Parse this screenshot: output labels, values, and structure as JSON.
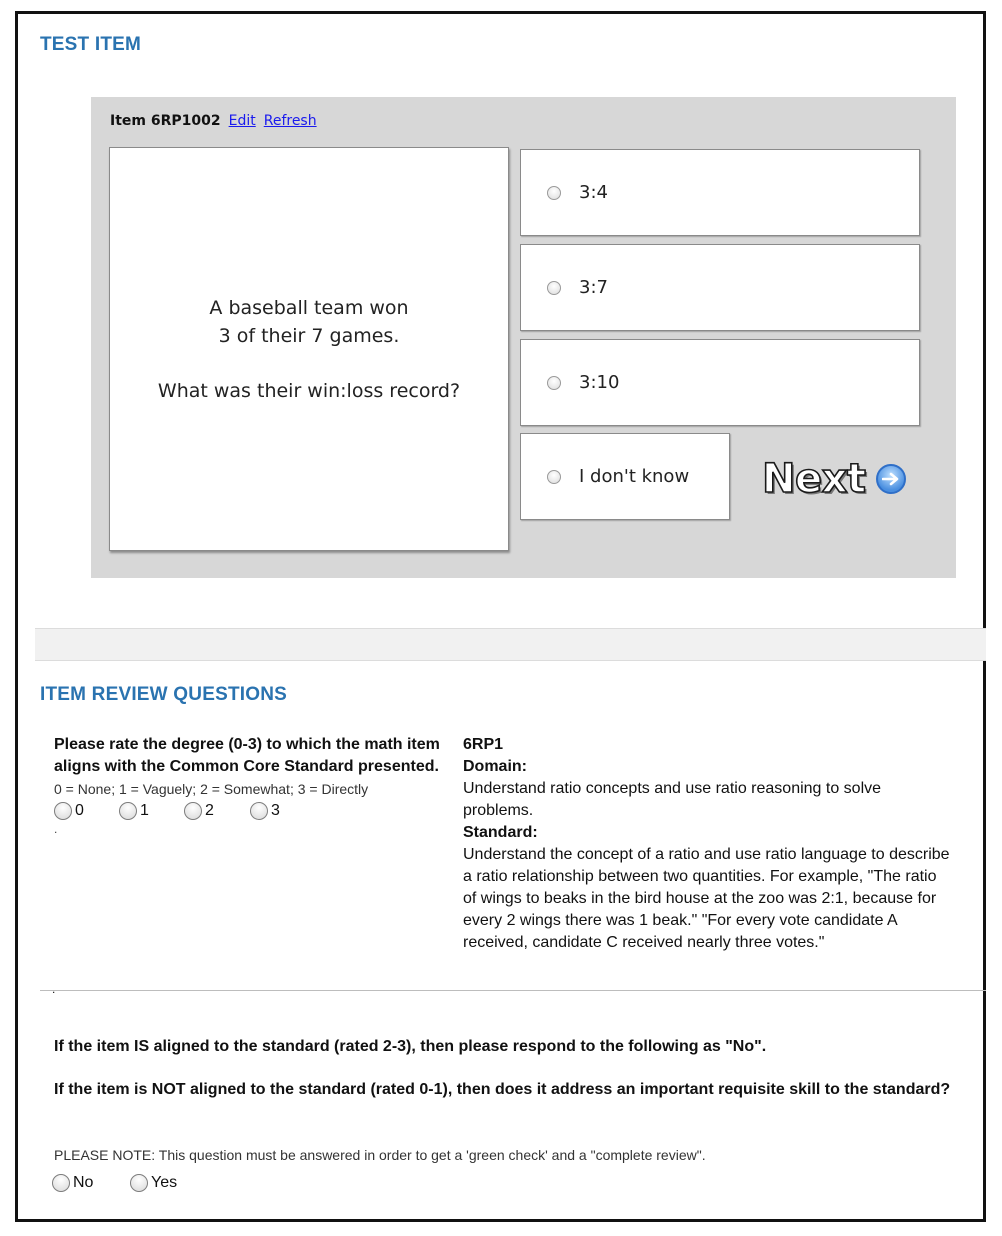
{
  "test_item": {
    "section_title": "TEST ITEM",
    "item_label": "Item 6RP1002",
    "edit_link": "Edit",
    "refresh_link": "Refresh",
    "question_lines": [
      "A baseball team won",
      "3 of their 7 games."
    ],
    "question_prompt": "What was their win:loss record?",
    "choices": [
      "3:4",
      "3:7",
      "3:10",
      "I don't know"
    ],
    "next_label": "Next",
    "next_icon": "arrow-right-circle-icon"
  },
  "review": {
    "section_title": "ITEM REVIEW QUESTIONS",
    "rate_question": "Please rate the degree (0-3) to which the math item aligns with the Common Core Standard presented.",
    "rate_key": "0 = None; 1 = Vaguely; 2 = Somewhat; 3 = Directly",
    "rate_options": [
      "0",
      "1",
      "2",
      "3"
    ],
    "dot": ".",
    "standard_code": "6RP1",
    "domain_label": "Domain:",
    "domain_text": "Understand ratio concepts and use ratio reasoning to solve problems.",
    "standard_label": "Standard:",
    "standard_text": "Understand the concept of a ratio and use ratio language to describe a ratio relationship between two quantities. For example, \"The ratio of wings to beaks in the bird house at the zoo was 2:1, because for every 2 wings there was 1 beak.\" \"For every vote candidate A received, candidate C received nearly three votes.\"",
    "aligned_instruction": "If the item IS aligned to the standard (rated 2-3), then please respond to the following as \"No\".",
    "not_aligned_question": "If the item is NOT aligned to the standard (rated 0-1), then does it address an important requisite skill to the standard?",
    "note": "PLEASE NOTE: This question must be answered in order to get a 'green check' and a \"complete review\".",
    "yes_no_options": [
      "No",
      "Yes"
    ]
  },
  "colors": {
    "section_title": "#2a73b0",
    "panel_bg": "#d7d7d7",
    "link": "#1a1aee"
  }
}
